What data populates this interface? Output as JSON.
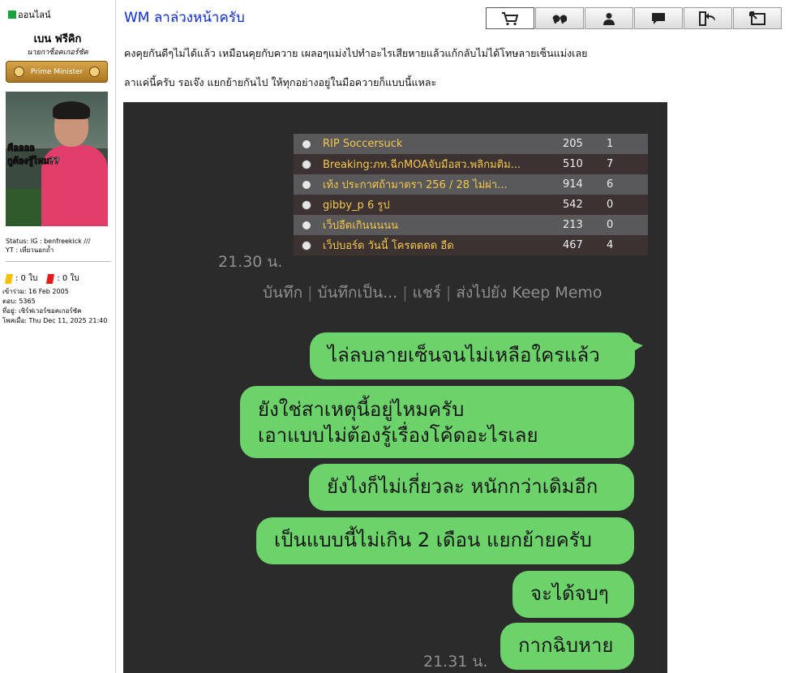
{
  "sidebar": {
    "online": "ออนไลน์",
    "username": "เบน ฟรีคิก",
    "user_title": "นายกาซ็อคเกอร์ซัค",
    "rank": "Prime Minister",
    "avatar_caption": [
      "คืออออ",
      "กูต้องรู้ไหม??"
    ],
    "status_line1": "Status: IG : benfreekick ///",
    "status_line2": "YT : เที่ยวนอกถ้ำ",
    "yellow_cards": ": 0 ใบ",
    "red_cards": ": 0 ใบ",
    "joined": "เข้าร่วม: 16 Feb 2005",
    "posts": "ตอบ: 5365",
    "location": "ที่อยู่: เซิร์ฟเวอร์ซอคเกอร์ซัค",
    "posted": "โพสเมื่อ: Thu Dec 11, 2025 21:40"
  },
  "post": {
    "title": "WM ลาล่วงหน้าครับ",
    "line1": "คงคุยกันดีๆไม่ได้แล้ว เหมือนคุยกับควาย เผลอๆแม่งไปทำอะไรเสียหายแล้วแก้กลับไม่ได้โทษลายเซ็นแม่งเลย",
    "line2": "ลาแค่นี้ครับ รอเจ๊ง แยกย้ายกันไป ให้ทุกอย่างอยู่ในมือควายก็แบบนี้แหละ"
  },
  "toolbar": {
    "icons": [
      "cart-icon",
      "quote-icon",
      "profile-icon",
      "message-icon",
      "back-icon",
      "reply-icon"
    ]
  },
  "screenshot": {
    "table_rows": [
      {
        "title": "RIP Soccersuck",
        "views": "205",
        "replies": "1"
      },
      {
        "title": "Breaking:ภท.ฉีกMOAจับมือสว.พลิกมติม...",
        "views": "510",
        "replies": "7"
      },
      {
        "title": "เท้ง ประกาศถ้ามาตรา 256 / 28 ไม่ผ่า...",
        "views": "914",
        "replies": "6"
      },
      {
        "title": "gibby_p 6 รูป",
        "views": "542",
        "replies": "0"
      },
      {
        "title": "เว็ปอืดเกินนนนน",
        "views": "213",
        "replies": "0"
      },
      {
        "title": "เว็ปบอร์ด วันนี้ โครตดดด อืด",
        "views": "467",
        "replies": "4"
      }
    ],
    "time1": "21.30 น.",
    "actions": [
      "บันทึก",
      "บันทึกเป็น...",
      "แชร์",
      "ส่งไปยัง Keep Memo"
    ],
    "bubbles": {
      "b1": "ไล่ลบลายเซ็นจนไม่เหลือใครแล้ว",
      "b2_line1": "ยังใช่สาเหตุนี้อยู่ไหมครับ",
      "b2_line2": "เอาแบบไม่ต้องรู้เรื่องโค้ดอะไรเลย",
      "b3": "ยังไงก็ไม่เกี่ยวละ หนักกว่าเดิมอีก",
      "b4": "เป็นแบบนี้ไม่เกิน 2 เดือน แยกย้ายครับ",
      "b5": "จะได้จบๆ",
      "b6": "กากฉิบหาย"
    },
    "time2": "21.31 น."
  }
}
